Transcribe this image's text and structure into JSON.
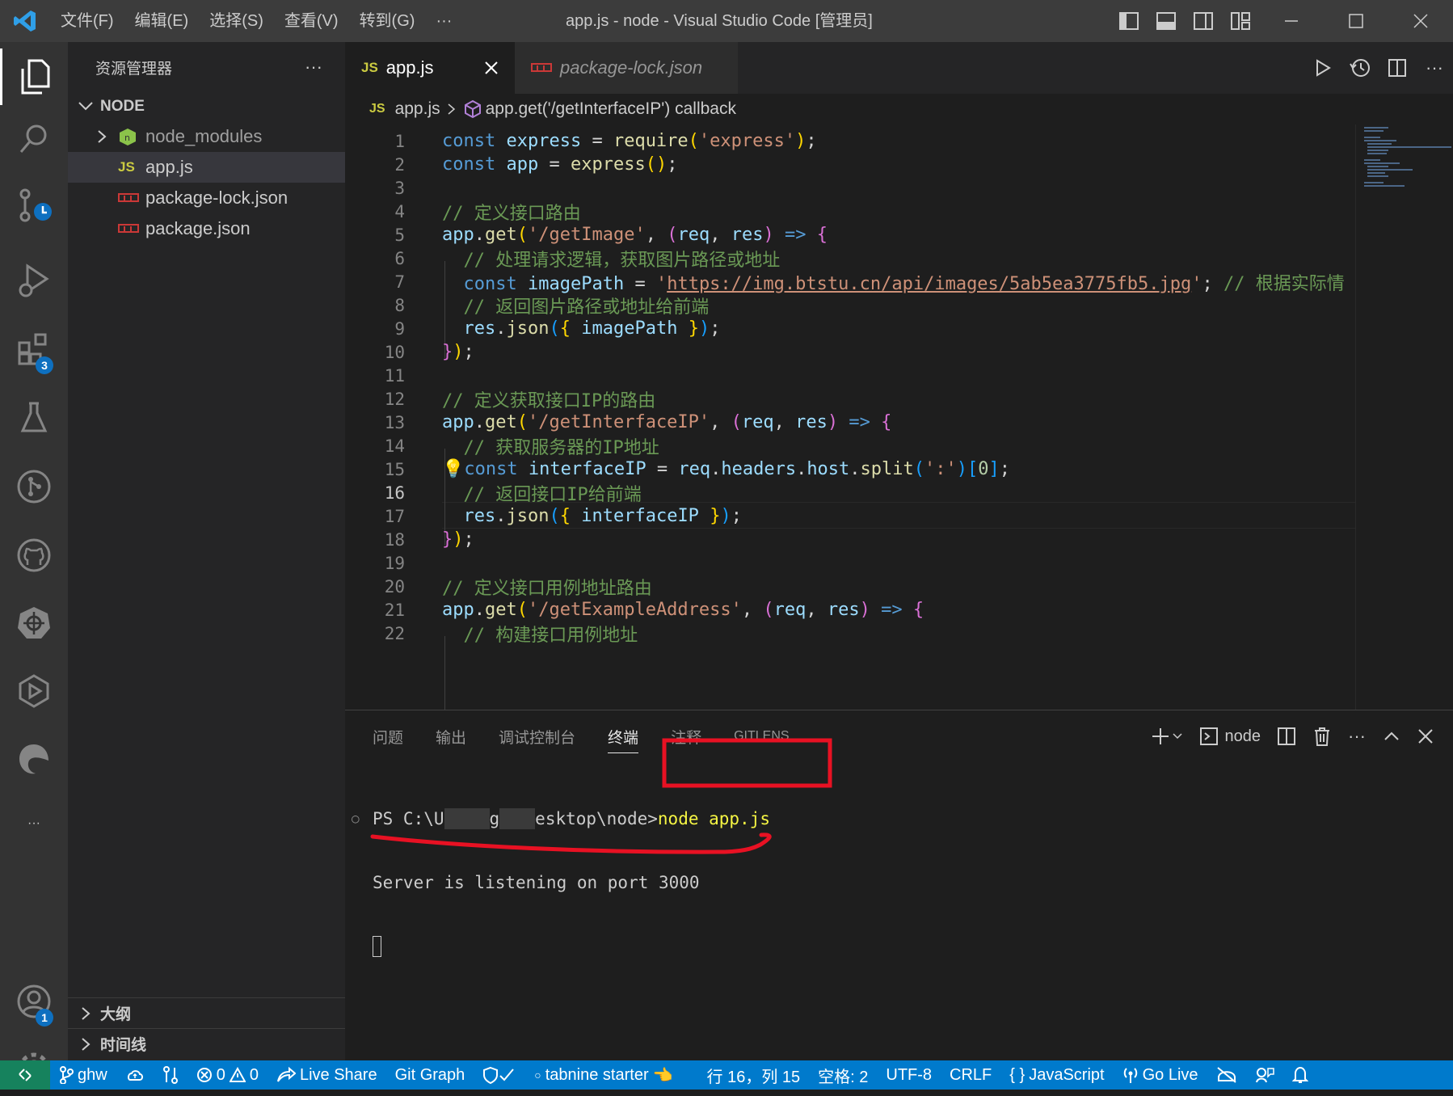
{
  "titlebar": {
    "menu": [
      "文件(F)",
      "编辑(E)",
      "选择(S)",
      "查看(V)",
      "转到(G)",
      "···"
    ],
    "title": "app.js - node - Visual Studio Code [管理员]"
  },
  "activity_bar": {
    "extensions_badge": "3",
    "accounts_badge": "1",
    "more": "···"
  },
  "sidebar": {
    "header": "资源管理器",
    "more": "···",
    "folder": "NODE",
    "items": [
      {
        "label": "node_modules",
        "type": "folder"
      },
      {
        "label": "app.js",
        "type": "js",
        "icon_text": "JS"
      },
      {
        "label": "package-lock.json",
        "type": "npm"
      },
      {
        "label": "package.json",
        "type": "npm"
      }
    ],
    "outline": "大纲",
    "timeline": "时间线"
  },
  "editor": {
    "tabs": [
      {
        "label": "app.js",
        "icon_text": "JS",
        "active": true
      },
      {
        "label": "package-lock.json",
        "active": false
      }
    ],
    "breadcrumb": {
      "file": "app.js",
      "icon_text": "JS",
      "symbol": "app.get('/getInterfaceIP') callback"
    },
    "current_line": 16,
    "line_numbers": [
      "1",
      "2",
      "3",
      "4",
      "5",
      "6",
      "7",
      "8",
      "9",
      "10",
      "11",
      "12",
      "13",
      "14",
      "15",
      "16",
      "17",
      "18",
      "19",
      "20",
      "21",
      "22"
    ]
  },
  "panel": {
    "tabs": [
      "问题",
      "输出",
      "调试控制台",
      "终端",
      "注释",
      "GITLENS"
    ],
    "active_tab": "终端",
    "terminal_name": "node",
    "terminal": {
      "prompt_start": "PS C:\\U",
      "prompt_mid1": "g",
      "prompt_mid2": "esktop\\node",
      "prompt_gt": ">",
      "command": "node app.js",
      "output": "Server is listening on port 3000"
    }
  },
  "statusbar": {
    "branch": "ghw",
    "errors": "0",
    "warnings": "0",
    "live_share": "Live Share",
    "git_graph": "Git Graph",
    "tabnine": "tabnine starter",
    "position": "行 16，列 15",
    "spaces": "空格: 2",
    "encoding": "UTF-8",
    "eol": "CRLF",
    "language": "JavaScript",
    "go_live": "Go Live"
  },
  "colors": {
    "accent": "#007acc",
    "annotation_red": "#e81123",
    "js_yellow": "#cbcb41",
    "npm_red": "#cb3837"
  }
}
